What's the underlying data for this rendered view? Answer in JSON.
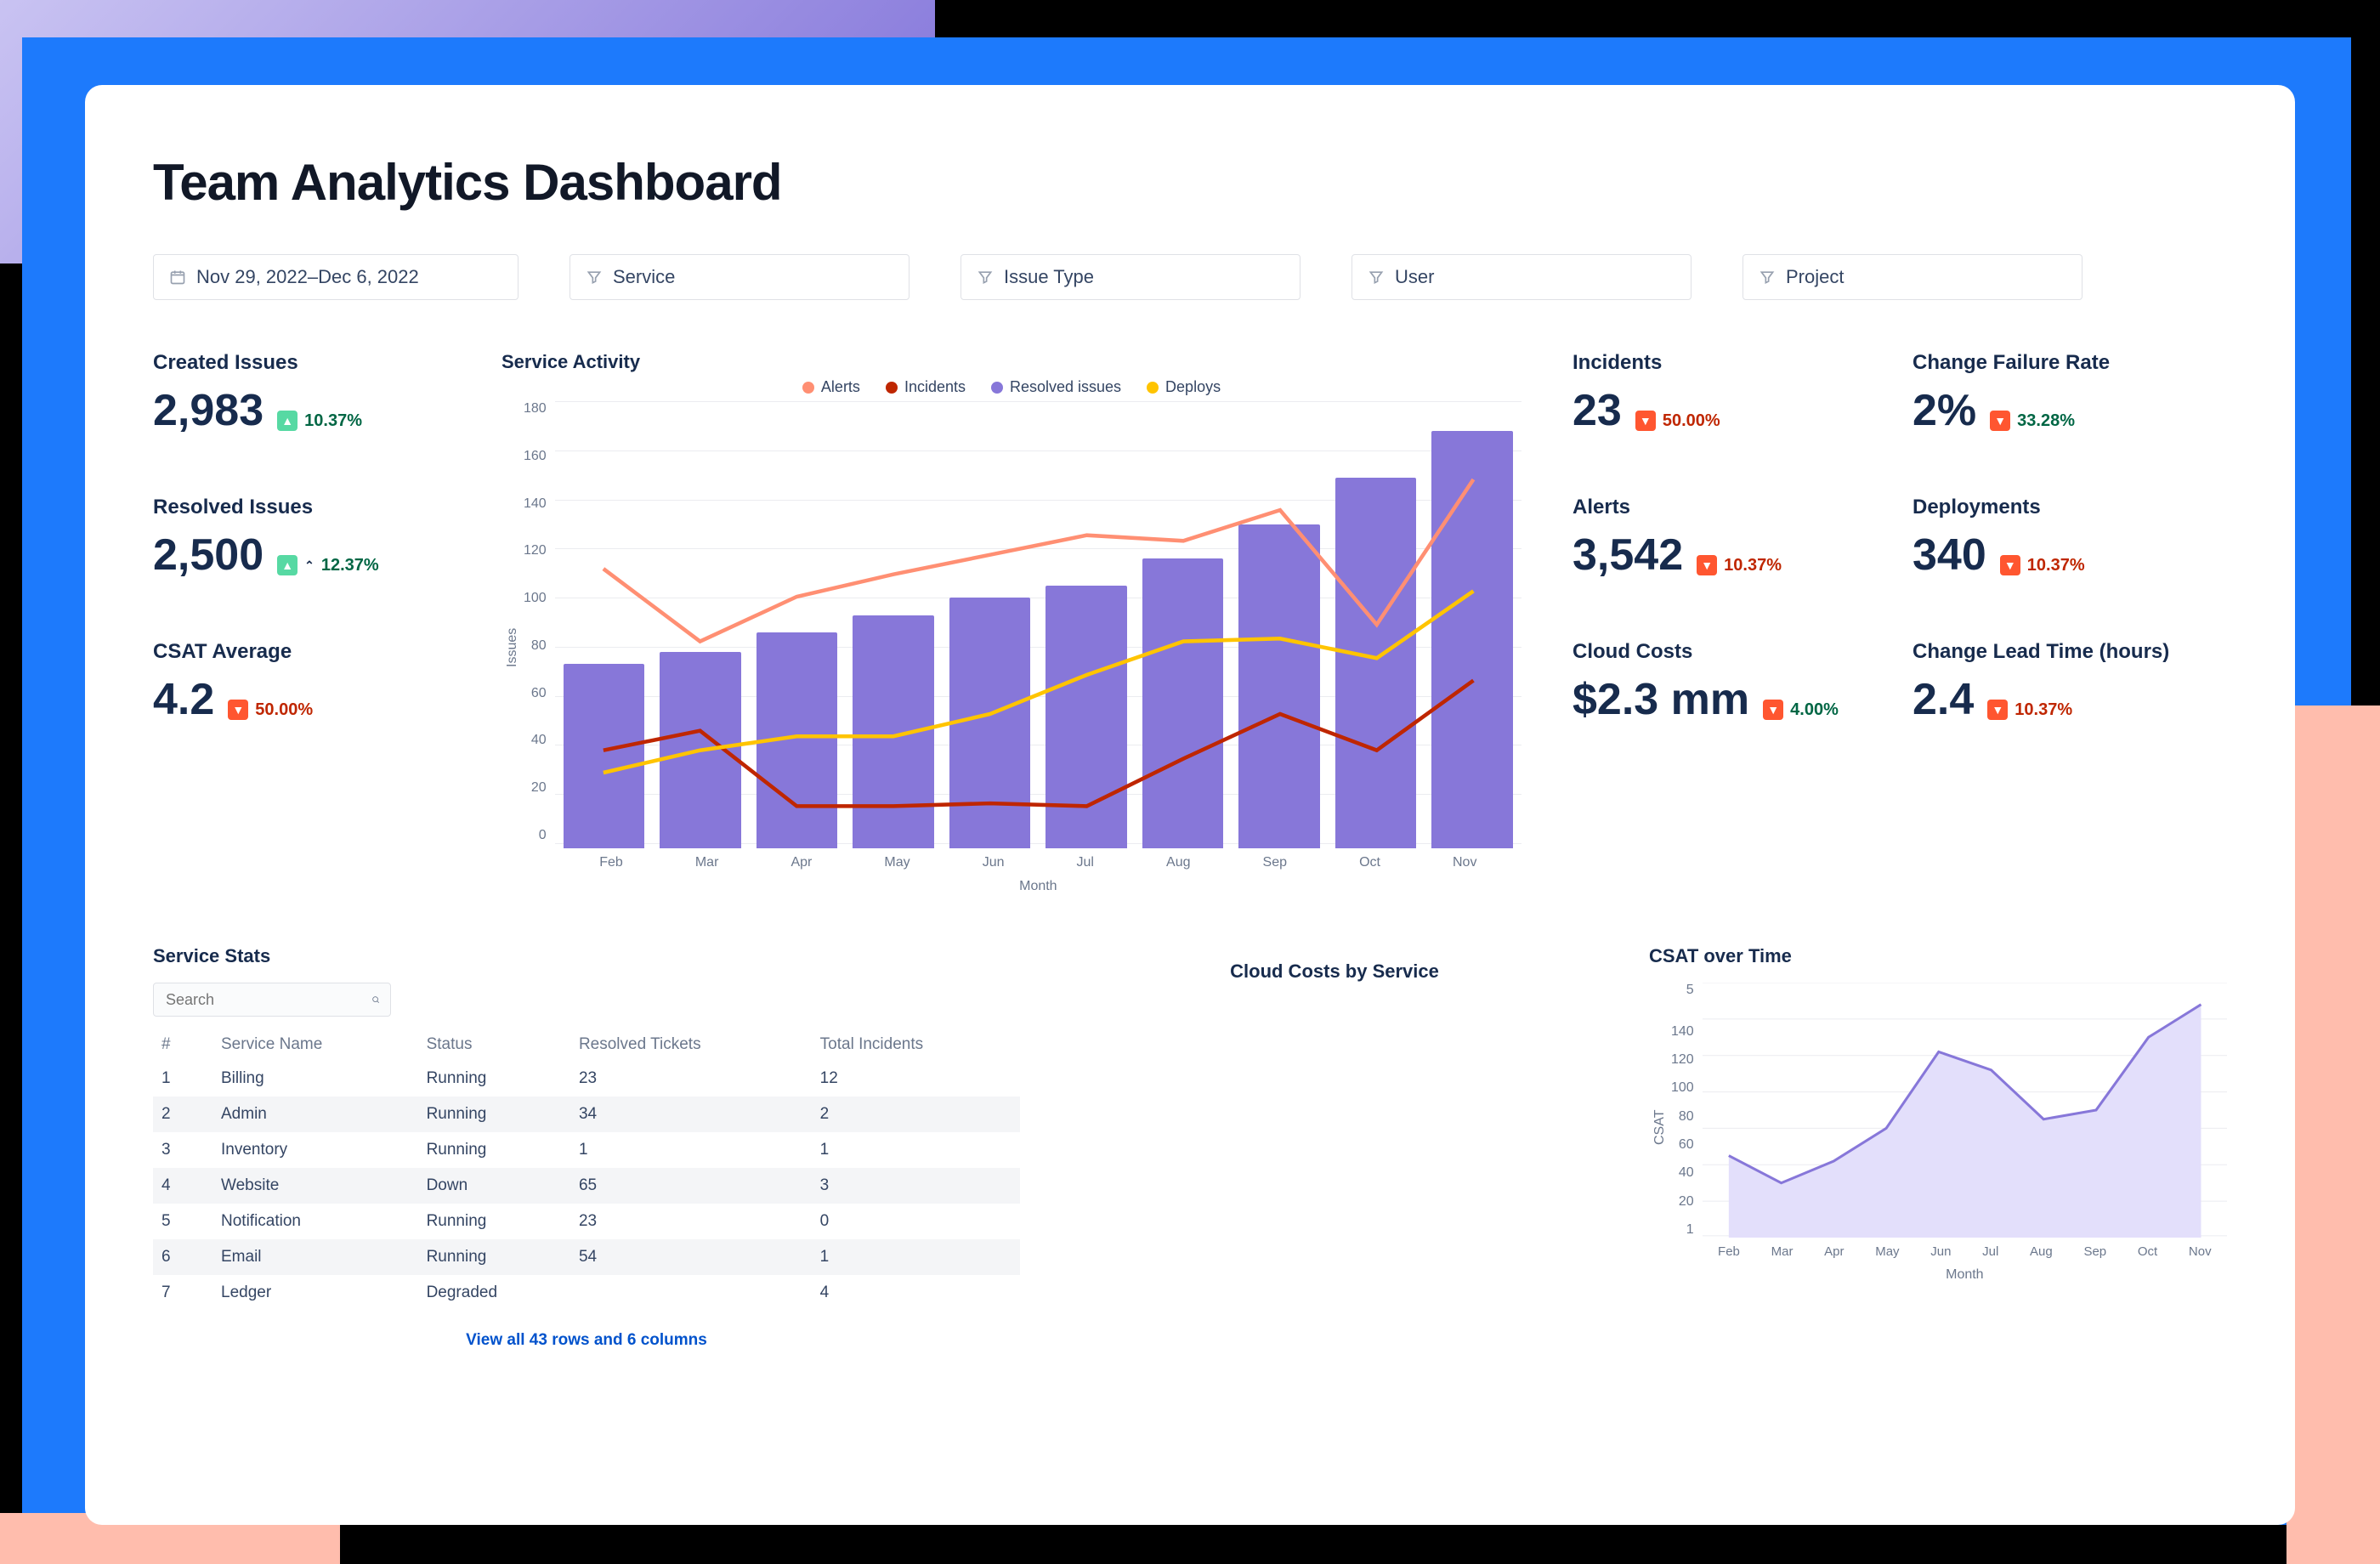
{
  "page_title": "Team Analytics Dashboard",
  "filters": {
    "date_range": "Nov 29, 2022–Dec 6, 2022",
    "service": "Service",
    "issue_type": "Issue Type",
    "user": "User",
    "project": "Project"
  },
  "kpi_left": [
    {
      "label": "Created Issues",
      "value": "2,983",
      "delta": "10.37%",
      "dir": "green"
    },
    {
      "label": "Resolved Issues",
      "value": "2,500",
      "delta": "12.37%",
      "dir": "green",
      "caret": true
    },
    {
      "label": "CSAT Average",
      "value": "4.2",
      "delta": "50.00%",
      "dir": "red"
    }
  ],
  "kpi_right_a": [
    {
      "label": "Incidents",
      "value": "23",
      "delta": "50.00%",
      "dir": "red"
    },
    {
      "label": "Alerts",
      "value": "3,542",
      "delta": "10.37%",
      "dir": "red"
    },
    {
      "label": "Cloud Costs",
      "value": "$2.3 mm",
      "delta": "4.00%",
      "dir": "red_green"
    }
  ],
  "kpi_right_b": [
    {
      "label": "Change Failure Rate",
      "value": "2%",
      "delta": "33.28%",
      "dir": "red_green"
    },
    {
      "label": "Deployments",
      "value": "340",
      "delta": "10.37%",
      "dir": "red"
    },
    {
      "label": "Change Lead Time (hours)",
      "value": "2.4",
      "delta": "10.37%",
      "dir": "red"
    }
  ],
  "chart_data": {
    "type": "bar+line",
    "title": "Service Activity",
    "xlabel": "Month",
    "ylabel": "Issues",
    "ylim": [
      0,
      180
    ],
    "y_ticks": [
      0,
      20,
      40,
      60,
      80,
      100,
      120,
      140,
      160,
      180
    ],
    "categories": [
      "Feb",
      "Mar",
      "Apr",
      "May",
      "Jun",
      "Jul",
      "Aug",
      "Sep",
      "Oct",
      "Nov"
    ],
    "series": [
      {
        "name": "Resolved issues",
        "kind": "bar",
        "color": "#8777D9",
        "values": [
          75,
          80,
          88,
          95,
          102,
          107,
          118,
          132,
          151,
          170
        ]
      },
      {
        "name": "Alerts",
        "kind": "line",
        "color": "#FF8F73",
        "values": [
          120,
          94,
          110,
          118,
          125,
          132,
          130,
          141,
          100,
          152
        ]
      },
      {
        "name": "Incidents",
        "kind": "line",
        "color": "#BF2600",
        "values": [
          55,
          62,
          35,
          35,
          36,
          35,
          52,
          68,
          55,
          80
        ]
      },
      {
        "name": "Deploys",
        "kind": "line",
        "color": "#FFC400",
        "values": [
          47,
          55,
          60,
          60,
          68,
          82,
          94,
          95,
          88,
          112
        ]
      }
    ],
    "legend": [
      "Alerts",
      "Incidents",
      "Resolved issues",
      "Deploys"
    ]
  },
  "service_stats": {
    "title": "Service Stats",
    "search_placeholder": "Search",
    "columns": [
      "#",
      "Service Name",
      "Status",
      "Resolved Tickets",
      "Total Incidents"
    ],
    "rows": [
      {
        "n": "1",
        "name": "Billing",
        "status": "Running",
        "resolved": "23",
        "incidents": "12"
      },
      {
        "n": "2",
        "name": "Admin",
        "status": "Running",
        "resolved": "34",
        "incidents": "2"
      },
      {
        "n": "3",
        "name": "Inventory",
        "status": "Running",
        "resolved": "1",
        "incidents": "1"
      },
      {
        "n": "4",
        "name": "Website",
        "status": "Down",
        "resolved": "65",
        "incidents": "3"
      },
      {
        "n": "5",
        "name": "Notification",
        "status": "Running",
        "resolved": "23",
        "incidents": "0"
      },
      {
        "n": "6",
        "name": "Email",
        "status": "Running",
        "resolved": "54",
        "incidents": "1"
      },
      {
        "n": "7",
        "name": "Ledger",
        "status": "Degraded",
        "resolved": "",
        "incidents": "4"
      }
    ],
    "view_all": "View all 43 rows and 6 columns"
  },
  "cloud_costs_title": "Cloud Costs by Service",
  "csat_chart": {
    "type": "area",
    "title": "CSAT over Time",
    "xlabel": "Month",
    "ylabel": "CSAT",
    "categories": [
      "Feb",
      "Mar",
      "Apr",
      "May",
      "Jun",
      "Jul",
      "Aug",
      "Sep",
      "Oct",
      "Nov"
    ],
    "y_ticks": [
      "5",
      "",
      "140",
      "120",
      "100",
      "80",
      "60",
      "40",
      "20",
      "1"
    ],
    "values": [
      45,
      30,
      42,
      60,
      102,
      92,
      65,
      70,
      110,
      128
    ]
  }
}
